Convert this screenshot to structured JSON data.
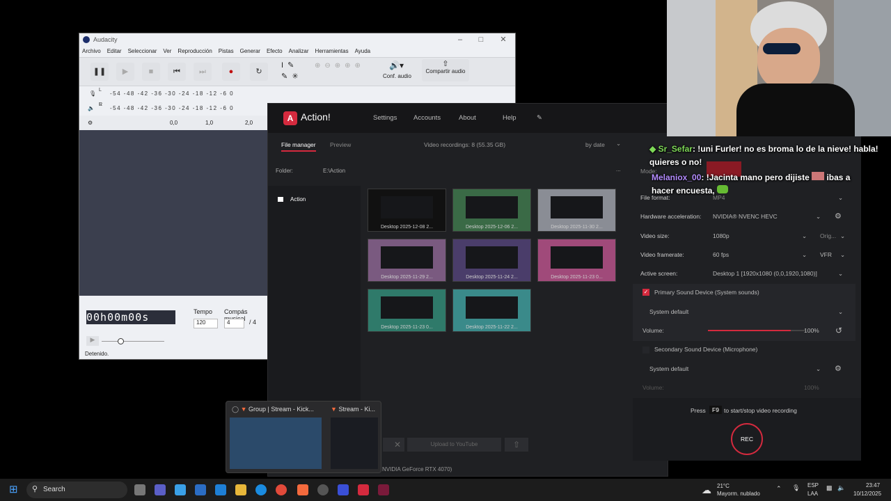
{
  "audacity": {
    "title": "Audacity",
    "menu": [
      "Archivo",
      "Editar",
      "Seleccionar",
      "Ver",
      "Reproducción",
      "Pistas",
      "Generar",
      "Efecto",
      "Analizar",
      "Herramientas",
      "Ayuda"
    ],
    "conf_audio": "Conf. audio",
    "share_audio": "Compartir audio",
    "meter_scale": "-54 -48 -42 -36 -30 -24 -18 -12 -6 0",
    "meter_scale_out": "-54 -48 -42 -36 -30 -24 -18 -12 -6 0",
    "ruler": [
      "0,0",
      "1,0",
      "2,0"
    ],
    "time": "00h00m00s",
    "tempo_label": "Tempo",
    "tempo_value": "120",
    "compas_label": "Compás musical",
    "compas_num": "4",
    "compas_den": "4",
    "status": "Detenido."
  },
  "action": {
    "brand": "Action!",
    "nav": [
      "Settings",
      "Accounts",
      "About",
      "Help"
    ],
    "tabs": {
      "file_manager": "File manager",
      "preview": "Preview"
    },
    "recordings_summary": "Video recordings: 8 (55.35 GB)",
    "sort": "by date",
    "folder_label": "Folder:",
    "folder_path": "E:\\Action",
    "more": "...",
    "sidebar_folder": "Action",
    "thumbnails": [
      "Desktop 2025-12-08 2...",
      "Desktop 2025-12-06 2...",
      "Desktop 2025-11-30 2...",
      "Desktop 2025-11-29 2...",
      "Desktop 2025-11-24 2...",
      "Desktop 2025-11-23 0...",
      "Desktop 2025-11-23 0...",
      "Desktop 2025-11-22 2..."
    ],
    "upload_button": "Upload to YouTube",
    "gpu": "NVIDIA GeForce RTX 4070)"
  },
  "panel": {
    "mode_label": "Mode:",
    "file_format_label": "File format:",
    "file_format": "MP4",
    "hw_label": "Hardware acceleration:",
    "hw_value": "NVIDIA® NVENC HEVC",
    "size_label": "Video size:",
    "size_value": "1080p",
    "size_orig": "Orig...",
    "framerate_label": "Video framerate:",
    "framerate_value": "60 fps",
    "framerate_mode": "VFR",
    "screen_label": "Active screen:",
    "screen_value": "Desktop 1 [1920x1080 (0,0,1920,1080)]",
    "primary_sound": "Primary Sound Device (System sounds)",
    "system_default_1": "System default",
    "volume_label": "Volume:",
    "volume_value": "100%",
    "volume_level": 0.85,
    "secondary_sound": "Secondary Sound Device (Microphone)",
    "system_default_2": "System default",
    "volume2_label": "Volume:",
    "volume2_value": "100%",
    "press": "Press",
    "hotkey": "F9",
    "hotkey_desc": "to start/stop video recording",
    "rec": "REC",
    "accent": "#d42a3e"
  },
  "chat": [
    {
      "user": "Sr_Sefar",
      "user_color": "#7ed957",
      "text": ": !uni Furler! no es broma lo de la nieve! habla! quieres o no!"
    },
    {
      "user": "Melaniox_00",
      "user_color": "#b48cff",
      "text": ": !Jacinta mano pero dijiste",
      "text2": "ibas a hacer encuesta,"
    }
  ],
  "preview": {
    "items": [
      {
        "title": "Group | Stream - Kick..."
      },
      {
        "title": "Stream - Ki..."
      }
    ]
  },
  "taskbar": {
    "search": "Search",
    "weather_temp": "21°C",
    "weather_desc": "Mayorm. nublado",
    "lang": "ESP",
    "lang2": "LAA",
    "time": "23:47",
    "date": "10/12/2025"
  }
}
